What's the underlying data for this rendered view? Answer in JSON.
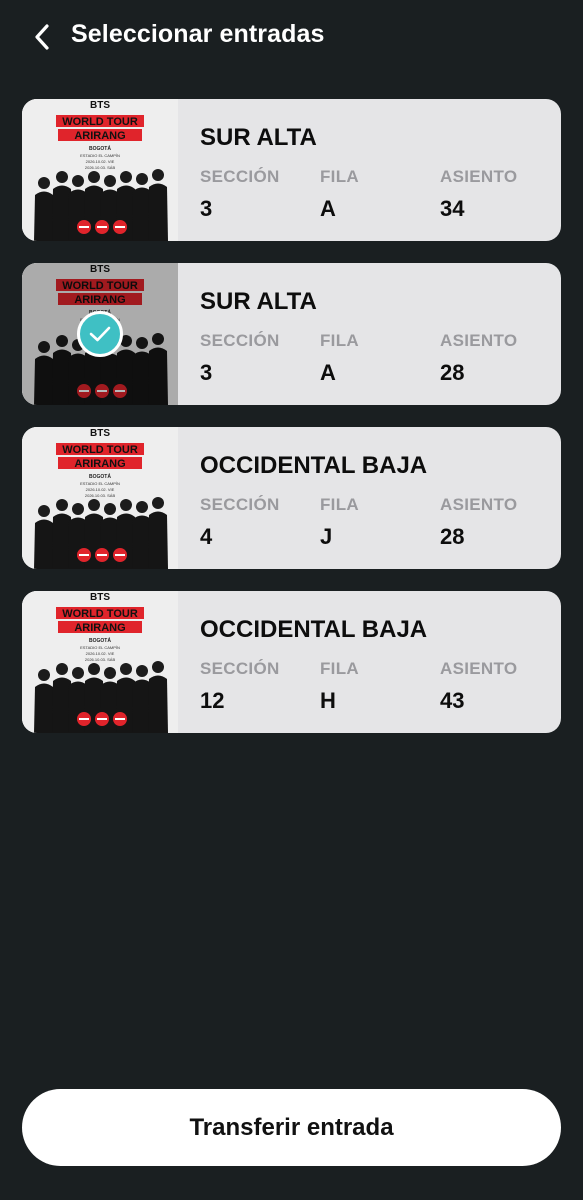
{
  "header": {
    "title": "Seleccionar entradas",
    "back_icon": "chevron-left-icon"
  },
  "labels": {
    "seccion": "SECCIÓN",
    "fila": "FILA",
    "asiento": "ASIENTO"
  },
  "poster": {
    "band": "BTS",
    "line1": "WORLD TOUR",
    "line2": "ARIRANG",
    "city": "BOGOTÁ",
    "venue": "ESTADIO EL CAMPÍN",
    "date1": "2026.10.02. VIE",
    "date2": "2026.10.03. SÁB",
    "accent": "#e0242b"
  },
  "tickets": [
    {
      "name": "SUR ALTA",
      "seccion": "3",
      "fila": "A",
      "asiento": "34",
      "selected": false
    },
    {
      "name": "SUR ALTA",
      "seccion": "3",
      "fila": "A",
      "asiento": "28",
      "selected": true
    },
    {
      "name": "OCCIDENTAL BAJA",
      "seccion": "4",
      "fila": "J",
      "asiento": "28",
      "selected": false
    },
    {
      "name": "OCCIDENTAL BAJA",
      "seccion": "12",
      "fila": "H",
      "asiento": "43",
      "selected": false
    }
  ],
  "footer": {
    "button_label": "Transferir entrada"
  },
  "colors": {
    "background": "#1a1f21",
    "card": "#e5e5e7",
    "check": "#3fc0c4"
  }
}
